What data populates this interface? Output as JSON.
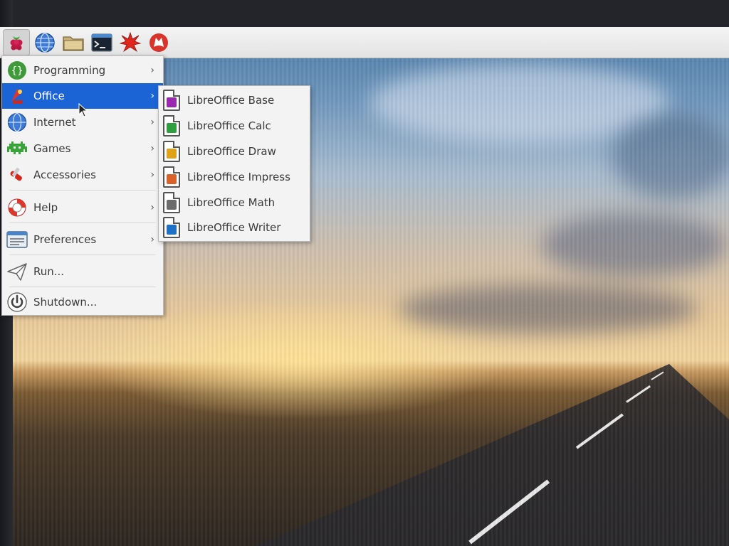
{
  "taskbar": {
    "buttons": [
      {
        "name": "raspberry-menu-button",
        "icon": "raspberry-icon"
      },
      {
        "name": "web-browser-button",
        "icon": "globe-icon"
      },
      {
        "name": "file-manager-button",
        "icon": "folder-icon"
      },
      {
        "name": "terminal-button",
        "icon": "terminal-icon"
      },
      {
        "name": "math-kernel-button",
        "icon": "starburst-icon"
      },
      {
        "name": "wolfram-button",
        "icon": "wolf-icon"
      }
    ]
  },
  "menu": {
    "items": [
      {
        "label": "Programming",
        "icon": "programming-icon",
        "has_submenu": true
      },
      {
        "label": "Office",
        "icon": "office-icon",
        "has_submenu": true,
        "selected": true
      },
      {
        "label": "Internet",
        "icon": "globe-icon",
        "has_submenu": true
      },
      {
        "label": "Games",
        "icon": "invader-icon",
        "has_submenu": true
      },
      {
        "label": "Accessories",
        "icon": "knife-icon",
        "has_submenu": true
      },
      {
        "label": "Help",
        "icon": "lifebuoy-icon",
        "has_submenu": true
      },
      {
        "label": "Preferences",
        "icon": "preferences-icon",
        "has_submenu": true
      },
      {
        "label": "Run...",
        "icon": "paper-plane-icon",
        "has_submenu": false
      },
      {
        "label": "Shutdown...",
        "icon": "power-icon",
        "has_submenu": false
      }
    ],
    "arrow": "›"
  },
  "submenu": {
    "items": [
      {
        "label": "LibreOffice Base",
        "icon": "libreoffice-base-icon",
        "color": "#9c27b0"
      },
      {
        "label": "LibreOffice Calc",
        "icon": "libreoffice-calc-icon",
        "color": "#2e9e3e"
      },
      {
        "label": "LibreOffice Draw",
        "icon": "libreoffice-draw-icon",
        "color": "#e0a21b"
      },
      {
        "label": "LibreOffice Impress",
        "icon": "libreoffice-impress-icon",
        "color": "#d9612a"
      },
      {
        "label": "LibreOffice Math",
        "icon": "libreoffice-math-icon",
        "color": "#6b6b6b"
      },
      {
        "label": "LibreOffice Writer",
        "icon": "libreoffice-writer-icon",
        "color": "#1f6fc4"
      }
    ]
  },
  "colors": {
    "selection": "#1a64d6",
    "menu_bg": "#f3f3f3"
  }
}
